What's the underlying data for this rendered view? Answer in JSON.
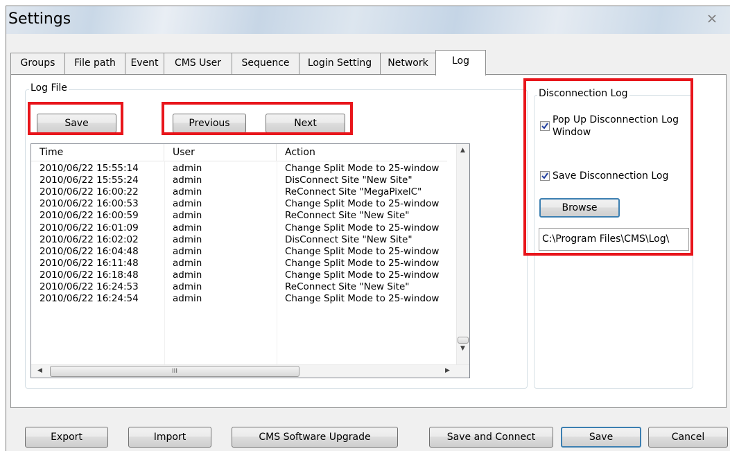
{
  "window": {
    "title": "Settings"
  },
  "tabs": [
    "Groups",
    "File path",
    "Event",
    "CMS User",
    "Sequence",
    "Login Setting",
    "Network",
    "Log"
  ],
  "active_tab": "Log",
  "log_file": {
    "legend": "Log File",
    "save_label": "Save",
    "previous_label": "Previous",
    "next_label": "Next",
    "columns": [
      "Time",
      "User",
      "Action"
    ],
    "rows": [
      [
        "2010/06/22 15:55:14",
        "admin",
        "Change Split Mode to 25-window"
      ],
      [
        "2010/06/22 15:55:24",
        "admin",
        "DisConnect Site \"New Site\""
      ],
      [
        "2010/06/22 16:00:22",
        "admin",
        "ReConnect Site \"MegaPixelC\""
      ],
      [
        "2010/06/22 16:00:53",
        "admin",
        "Change Split Mode to 25-window"
      ],
      [
        "2010/06/22 16:00:59",
        "admin",
        "ReConnect Site \"New Site\""
      ],
      [
        "2010/06/22 16:01:09",
        "admin",
        "Change Split Mode to 25-window"
      ],
      [
        "2010/06/22 16:02:02",
        "admin",
        "DisConnect Site \"New Site\""
      ],
      [
        "2010/06/22 16:04:48",
        "admin",
        "Change Split Mode to 25-window"
      ],
      [
        "2010/06/22 16:11:48",
        "admin",
        "Change Split Mode to 25-window"
      ],
      [
        "2010/06/22 16:18:48",
        "admin",
        "Change Split Mode to 25-window"
      ],
      [
        "2010/06/22 16:24:53",
        "admin",
        "ReConnect Site \"New Site\""
      ],
      [
        "2010/06/22 16:24:54",
        "admin",
        "Change Split Mode to 25-window"
      ]
    ],
    "hscroll_thumb_glyph": "III"
  },
  "disconnection_log": {
    "legend": "Disconnection Log",
    "popup_label": "Pop Up Disconnection Log Window",
    "popup_checked": true,
    "save_label": "Save Disconnection Log",
    "save_checked": true,
    "browse_label": "Browse",
    "path_value": "C:\\Program Files\\CMS\\Log\\"
  },
  "footer": {
    "export_label": "Export",
    "import_label": "Import",
    "upgrade_label": "CMS Software Upgrade",
    "save_connect_label": "Save and Connect",
    "save_label": "Save",
    "cancel_label": "Cancel"
  },
  "colors": {
    "highlight": "#e8151b",
    "focus_border": "#3c7fb1",
    "check": "#1f3d9e"
  }
}
